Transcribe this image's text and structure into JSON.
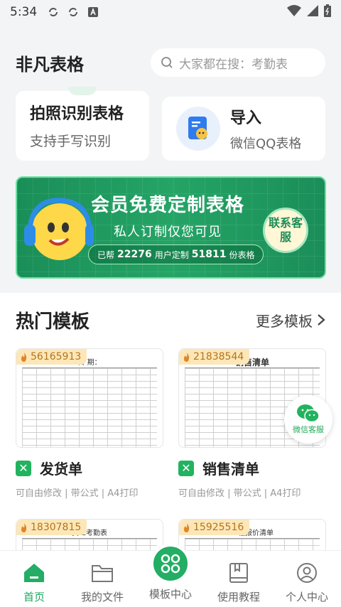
{
  "status": {
    "time": "5:34"
  },
  "header": {
    "title": "非凡表格",
    "search_placeholder": "大家都在搜：考勤表"
  },
  "quick": {
    "scan": {
      "title": "拍照识别表格",
      "subtitle": "支持手写识别"
    },
    "import": {
      "title": "导入",
      "subtitle": "微信QQ表格"
    }
  },
  "banner": {
    "title": "会员免费定制表格",
    "subtitle": "私人订制仅您可见",
    "pill_prefix": "已帮",
    "users": "22276",
    "pill_mid": "用户定制",
    "tables": "51811",
    "pill_suffix": "份表格",
    "contact": "联系客服"
  },
  "templates": {
    "section_title": "热门模板",
    "more": "更多模板",
    "items": [
      {
        "count": "56165913",
        "name": "发货单",
        "desc": "可自由修改 | 带公式 | A4打印",
        "sheet_heading": "日  期："
      },
      {
        "count": "21838544",
        "name": "销售清单",
        "desc": "可自由修改 | 带公式 | A4打印",
        "sheet_heading": "销售清单"
      },
      {
        "count": "18307815",
        "sheet_heading": "员工考勤表"
      },
      {
        "count": "15925516",
        "sheet_heading": "工程报价清单"
      }
    ]
  },
  "float_service": {
    "label": "微信客服"
  },
  "tabbar": {
    "items": [
      {
        "label": "首页"
      },
      {
        "label": "我的文件"
      },
      {
        "label": "模板中心"
      },
      {
        "label": "使用教程"
      },
      {
        "label": "个人中心"
      }
    ]
  },
  "colors": {
    "accent": "#1fa860",
    "banner": "#1a8e58",
    "badge": "#fde7b8"
  }
}
